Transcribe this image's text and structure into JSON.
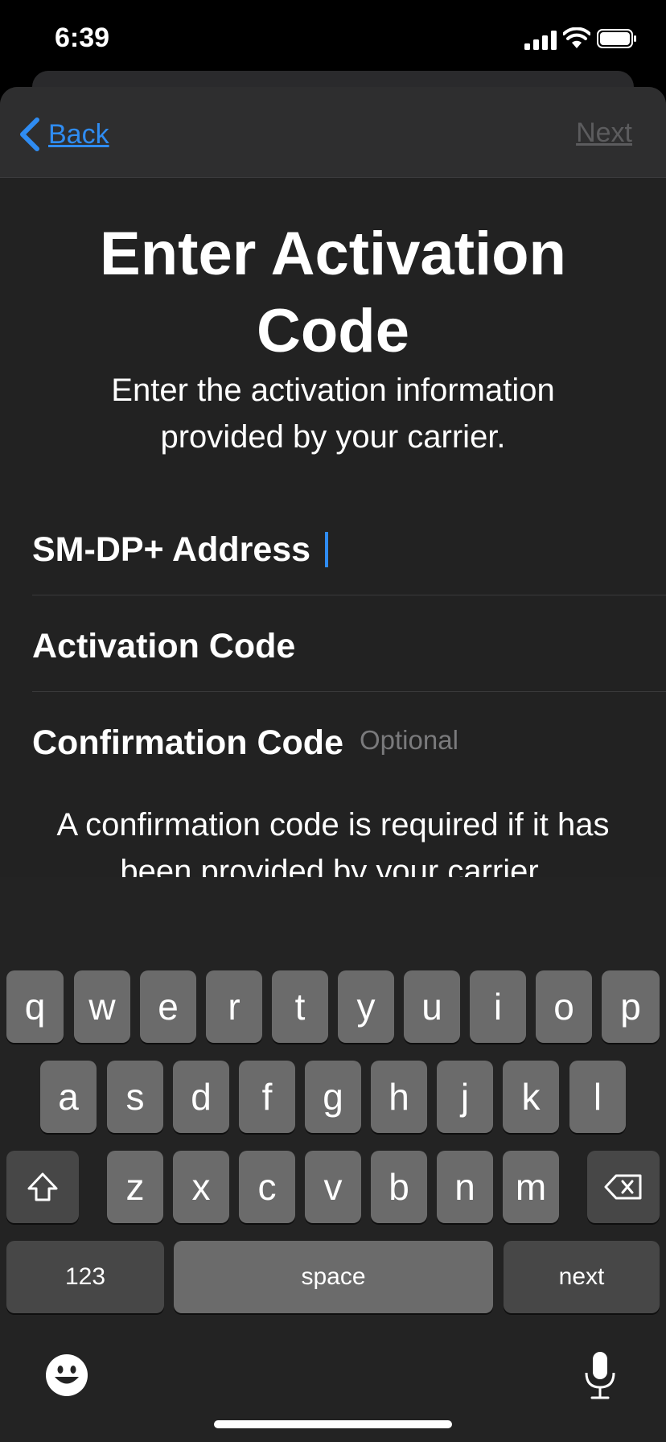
{
  "status": {
    "time": "6:39"
  },
  "nav": {
    "back_label": "Back",
    "next_label": "Next"
  },
  "title": "Enter Activation Code",
  "subtitle": "Enter the activation information provided by your carrier.",
  "fields": [
    {
      "label": "SM-DP+ Address",
      "value": "",
      "placeholder": ""
    },
    {
      "label": "Activation Code",
      "value": "",
      "placeholder": ""
    },
    {
      "label": "Confirmation Code",
      "value": "",
      "placeholder": "Optional"
    }
  ],
  "note": "A confirmation code is required if it has been provided by your carrier.",
  "keyboard": {
    "row1": [
      "q",
      "w",
      "e",
      "r",
      "t",
      "y",
      "u",
      "i",
      "o",
      "p"
    ],
    "row2": [
      "a",
      "s",
      "d",
      "f",
      "g",
      "h",
      "j",
      "k",
      "l"
    ],
    "row3": [
      "z",
      "x",
      "c",
      "v",
      "b",
      "n",
      "m"
    ],
    "numbers_label": "123",
    "space_label": "space",
    "return_label": "next"
  },
  "colors": {
    "accent": "#2f8cf2",
    "background": "#222222",
    "key": "#6b6b6b",
    "key_dark": "#474747"
  }
}
